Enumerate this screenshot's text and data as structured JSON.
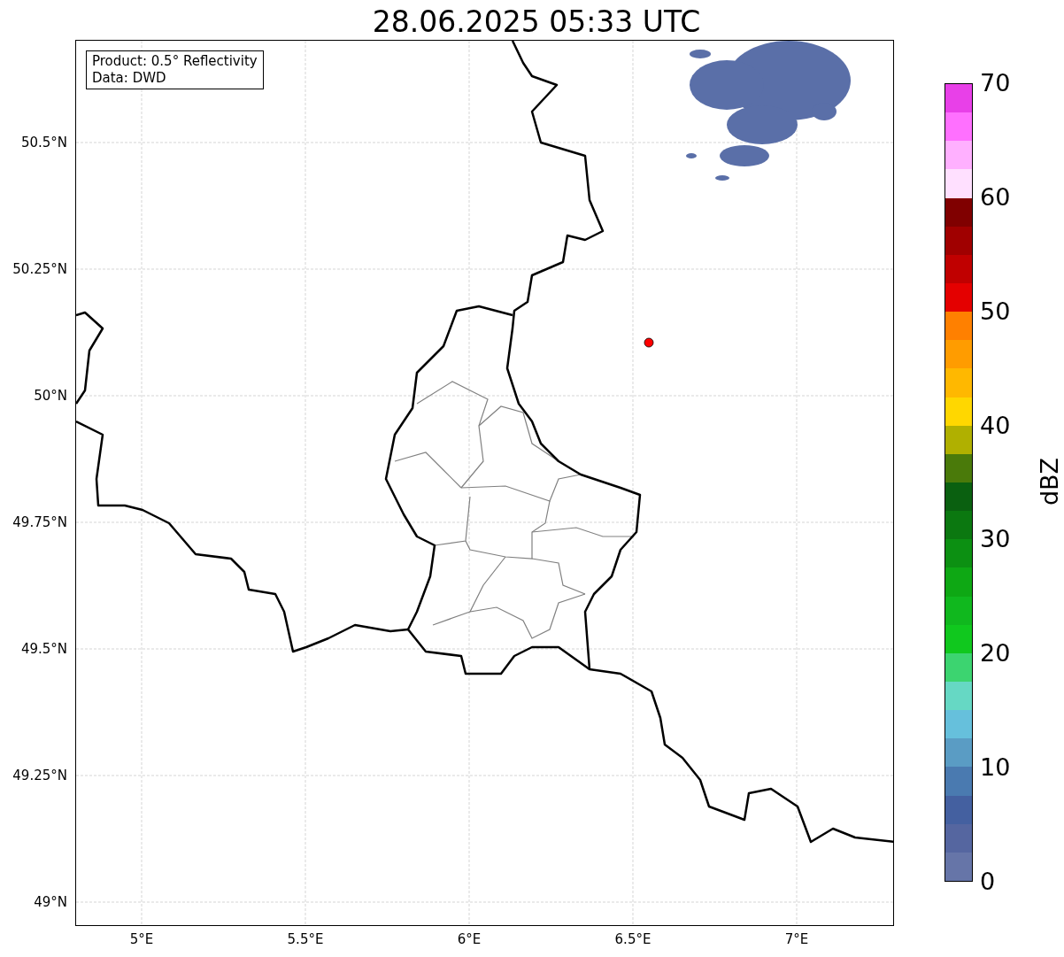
{
  "title": "28.06.2025 05:33 UTC",
  "info_box": [
    "Product: 0.5° Reflectivity",
    "Data: DWD"
  ],
  "y_ticks": [
    "50.5°N",
    "50.25°N",
    "50°N",
    "49.75°N",
    "49.5°N",
    "49.25°N",
    "49°N"
  ],
  "x_ticks": [
    "5°E",
    "5.5°E",
    "6°E",
    "6.5°E",
    "7°E"
  ],
  "colorbar": {
    "label": "dBZ",
    "ticks": [
      "70",
      "60",
      "50",
      "40",
      "30",
      "20",
      "10",
      "0"
    ],
    "bands": [
      {
        "color": "#e840e8"
      },
      {
        "color": "#ff70ff"
      },
      {
        "color": "#ffb0ff"
      },
      {
        "color": "#ffe0ff"
      },
      {
        "color": "#800000"
      },
      {
        "color": "#a00000"
      },
      {
        "color": "#c00000"
      },
      {
        "color": "#e40000"
      },
      {
        "color": "#ff8000"
      },
      {
        "color": "#ff9c00"
      },
      {
        "color": "#ffb800"
      },
      {
        "color": "#ffd700"
      },
      {
        "color": "#b0b000"
      },
      {
        "color": "#4a7a0a"
      },
      {
        "color": "#0a6010"
      },
      {
        "color": "#0b7810"
      },
      {
        "color": "#0c9012"
      },
      {
        "color": "#0ea814"
      },
      {
        "color": "#10b81e"
      },
      {
        "color": "#10c81e"
      },
      {
        "color": "#3cd470"
      },
      {
        "color": "#66d8c4"
      },
      {
        "color": "#66c0dc"
      },
      {
        "color": "#5a9cc4"
      },
      {
        "color": "#4a7ab0"
      },
      {
        "color": "#4460a0"
      },
      {
        "color": "#5566a0"
      },
      {
        "color": "#6675a8"
      }
    ]
  }
}
